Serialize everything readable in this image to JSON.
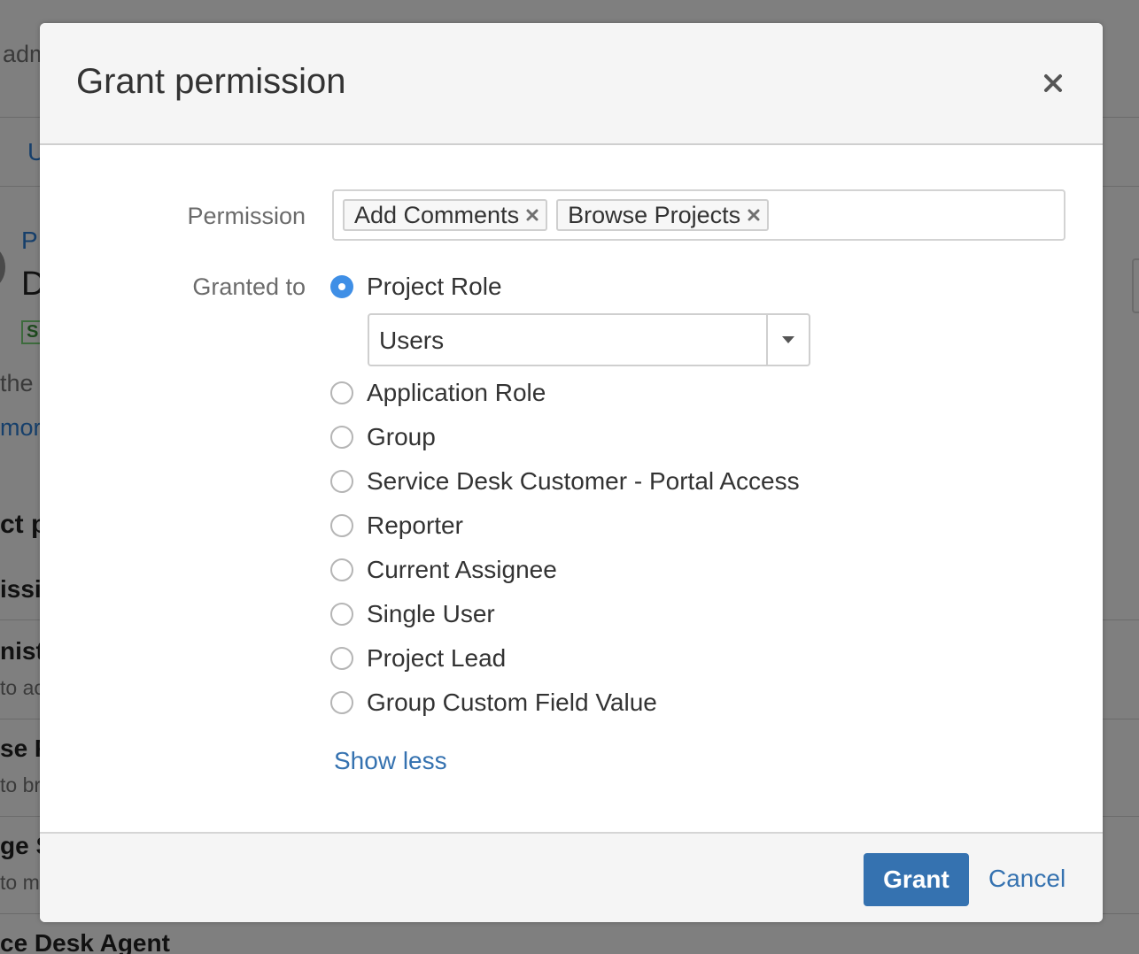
{
  "background": {
    "fragments": {
      "adm": "adm",
      "u": "U",
      "p": "P",
      "d": "D",
      "s": "S",
      "the": "the",
      "more": "more",
      "ctp": "ct p",
      "issi": "issi",
      "nist": "nist",
      "toac": "to ac",
      "se": "se F",
      "tobr": "to br",
      "ge": "ge S",
      "tom": "to m",
      "agent": "ce Desk Agent"
    }
  },
  "dialog": {
    "title": "Grant permission",
    "close_icon": "close-icon",
    "permission_label": "Permission",
    "permissions": [
      {
        "label": "Add Comments"
      },
      {
        "label": "Browse Projects"
      }
    ],
    "granted_to_label": "Granted to",
    "options": [
      {
        "label": "Project Role",
        "checked": true
      },
      {
        "label": "Application Role",
        "checked": false
      },
      {
        "label": "Group",
        "checked": false
      },
      {
        "label": "Service Desk Customer - Portal Access",
        "checked": false
      },
      {
        "label": "Reporter",
        "checked": false
      },
      {
        "label": "Current Assignee",
        "checked": false
      },
      {
        "label": "Single User",
        "checked": false
      },
      {
        "label": "Project Lead",
        "checked": false
      },
      {
        "label": "Group Custom Field Value",
        "checked": false
      }
    ],
    "role_select_value": "Users",
    "show_less": "Show less",
    "grant_button": "Grant",
    "cancel_link": "Cancel"
  },
  "colors": {
    "overlay": "#7f7f7f",
    "primary": "#3572b0",
    "radio_checked": "#3f8fe6"
  }
}
